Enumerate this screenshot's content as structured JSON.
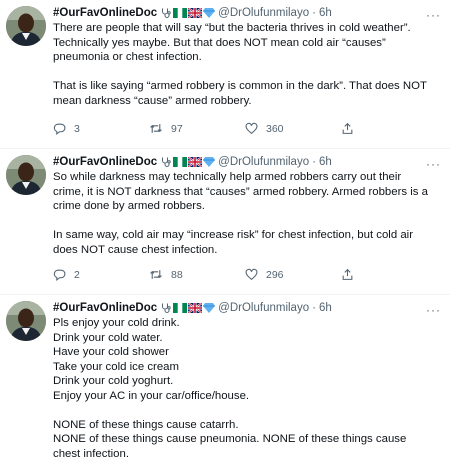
{
  "colors": {
    "text": "#0f1419",
    "muted": "#536471",
    "divider": "#eff3f4"
  },
  "tweets": [
    {
      "author": {
        "name": "#OurFavOnlineDoc",
        "handle": "@DrOlufunmilayo",
        "time": "6h"
      },
      "badges": [
        "stethoscope-icon",
        "nigeria-flag-icon",
        "uk-flag-icon",
        "blue-diamond-icon"
      ],
      "paragraphs": [
        "There are people that will say “but the bacteria thrives in cold weather”. Technically yes maybe. But that does NOT mean cold air “causes” pneumonia or chest infection.",
        "That is like saying “armed robbery is common in the dark”. That does NOT mean darkness “cause” armed robbery."
      ],
      "stats": {
        "replies": "3",
        "retweets": "97",
        "likes": "360"
      }
    },
    {
      "author": {
        "name": "#OurFavOnlineDoc",
        "handle": "@DrOlufunmilayo",
        "time": "6h"
      },
      "badges": [
        "stethoscope-icon",
        "nigeria-flag-icon",
        "uk-flag-icon",
        "blue-diamond-icon"
      ],
      "paragraphs": [
        "So while darkness may technically help armed robbers carry out their crime, it is NOT darkness that “causes” armed robbery. Armed robbers is a crime done by armed robbers.",
        "In same way, cold air may “increase risk” for chest infection, but cold air does NOT cause chest infection."
      ],
      "stats": {
        "replies": "2",
        "retweets": "88",
        "likes": "296"
      }
    },
    {
      "author": {
        "name": "#OurFavOnlineDoc",
        "handle": "@DrOlufunmilayo",
        "time": "6h"
      },
      "badges": [
        "stethoscope-icon",
        "nigeria-flag-icon",
        "uk-flag-icon",
        "blue-diamond-icon"
      ],
      "paragraphs": [
        "Pls enjoy your cold drink.\nDrink your cold water.\nHave your cold shower\nTake your cold ice cream\nDrink your cold yoghurt.\nEnjoy your AC in your car/office/house.",
        "NONE of these things cause catarrh.\nNONE of these things cause pneumonia. NONE of these things cause chest infection."
      ]
    }
  ]
}
